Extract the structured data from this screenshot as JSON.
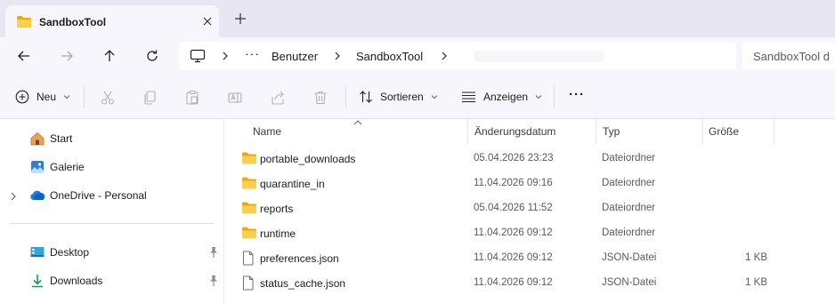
{
  "tab": {
    "title": "SandboxTool"
  },
  "breadcrumb": {
    "overflow": "···",
    "items": [
      "Benutzer",
      "SandboxTool"
    ]
  },
  "search": {
    "placeholder": "SandboxTool d"
  },
  "commands": {
    "new_label": "Neu",
    "sort_label": "Sortieren",
    "view_label": "Anzeigen",
    "more_label": "···"
  },
  "sidebar": {
    "items": [
      {
        "label": "Start",
        "icon": "home-icon"
      },
      {
        "label": "Galerie",
        "icon": "gallery-icon"
      },
      {
        "label": "OneDrive - Personal",
        "icon": "onedrive-cloud-icon"
      },
      {
        "label": "Desktop",
        "icon": "desktop-icon",
        "pinned": true
      },
      {
        "label": "Downloads",
        "icon": "download-icon",
        "pinned": true
      }
    ]
  },
  "columns": {
    "name": "Name",
    "date": "Änderungsdatum",
    "type": "Typ",
    "size": "Größe"
  },
  "files": [
    {
      "name": "portable_downloads",
      "date": "05.04.2026 23:23",
      "type": "Dateiordner",
      "size": "",
      "icon": "folder-icon"
    },
    {
      "name": "quarantine_in",
      "date": "11.04.2026 09:16",
      "type": "Dateiordner",
      "size": "",
      "icon": "folder-icon"
    },
    {
      "name": "reports",
      "date": "05.04.2026 11:52",
      "type": "Dateiordner",
      "size": "",
      "icon": "folder-icon"
    },
    {
      "name": "runtime",
      "date": "11.04.2026 09:12",
      "type": "Dateiordner",
      "size": "",
      "icon": "folder-icon"
    },
    {
      "name": "preferences.json",
      "date": "11.04.2026 09:12",
      "type": "JSON-Datei",
      "size": "1 KB",
      "icon": "file-icon"
    },
    {
      "name": "status_cache.json",
      "date": "11.04.2026 09:12",
      "type": "JSON-Datei",
      "size": "1 KB",
      "icon": "file-icon"
    }
  ],
  "colors": {
    "folder": "#f4c342",
    "accent": "#0a64c8",
    "titlebar": "#e8e6f3",
    "toolbar": "#f7f6fc"
  }
}
